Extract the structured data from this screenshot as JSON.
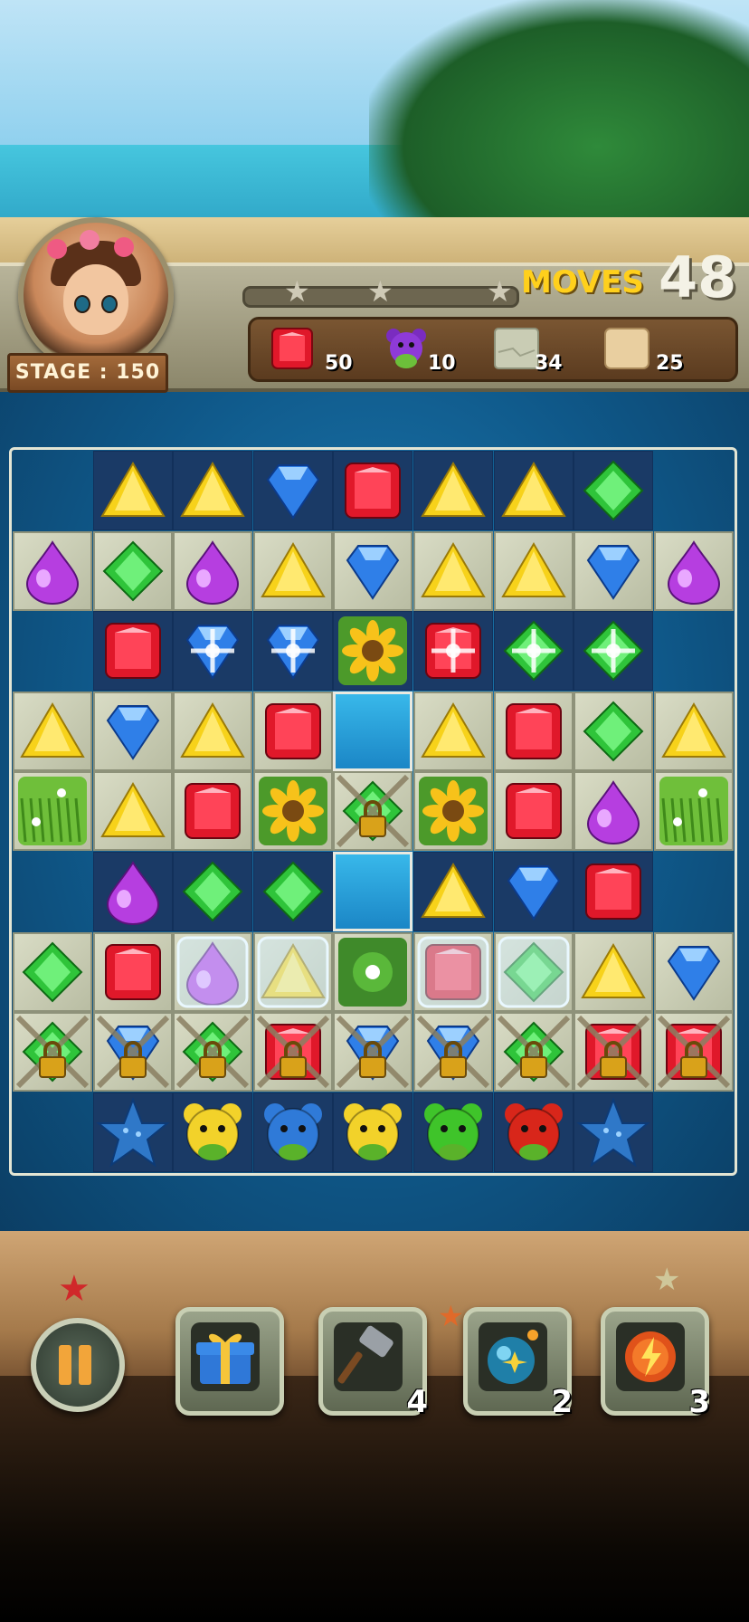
{
  "hud": {
    "stage_label": "STAGE : 150",
    "moves_label": "MOVES",
    "moves_value": "48",
    "progress_stars": 3,
    "progress_fraction": 0.0,
    "goals": [
      {
        "icon": "red-gem-icon",
        "count": "50"
      },
      {
        "icon": "purple-bear-icon",
        "count": "10"
      },
      {
        "icon": "stone-tile-icon",
        "count": "34"
      },
      {
        "icon": "sand-tile-icon",
        "count": "25"
      }
    ]
  },
  "board": {
    "rows": [
      [
        null,
        "Y",
        "Y",
        "B",
        "R",
        "Y",
        "Y",
        "G",
        null
      ],
      [
        "P",
        "G",
        "P",
        "Y",
        "B",
        "Y",
        "Y",
        "B",
        "P"
      ],
      [
        null,
        "R",
        "B*",
        "B*",
        "F",
        "R*",
        "G*",
        "G*",
        null
      ],
      [
        "Y",
        "B",
        "Y",
        "R",
        "H",
        "Y",
        "R",
        "G",
        "Y"
      ],
      [
        "S",
        "Y",
        "R",
        "F",
        "GL",
        "F",
        "R",
        "P",
        "S"
      ],
      [
        null,
        "P",
        "G",
        "G",
        "H",
        "Y",
        "B",
        "R",
        null
      ],
      [
        "G",
        "R",
        "PI",
        "YI",
        "L",
        "RI",
        "GI",
        "Y",
        "B"
      ],
      [
        "GL",
        "BL",
        "GL",
        "RL",
        "BL",
        "BL",
        "GL",
        "RL",
        "RL"
      ],
      [
        null,
        "ST",
        "KY",
        "KB",
        "KY",
        "KG",
        "KR",
        "ST",
        null
      ]
    ],
    "stone_rows": [
      1,
      3,
      4,
      6,
      7
    ]
  },
  "boosters": [
    {
      "name": "gift-booster",
      "icon": "gift-icon",
      "count": ""
    },
    {
      "name": "hammer-booster",
      "icon": "hammer-icon",
      "count": "4"
    },
    {
      "name": "bomb-booster",
      "icon": "bomb-icon",
      "count": "2"
    },
    {
      "name": "lightning-booster",
      "icon": "lightning-orb-icon",
      "count": "3"
    }
  ],
  "colors": {
    "red": "#e0182a",
    "yellow": "#f7d21a",
    "blue": "#2f7fe8",
    "green": "#2fc43a",
    "purple": "#b63ee0",
    "moves_label": "#ffd01c"
  }
}
